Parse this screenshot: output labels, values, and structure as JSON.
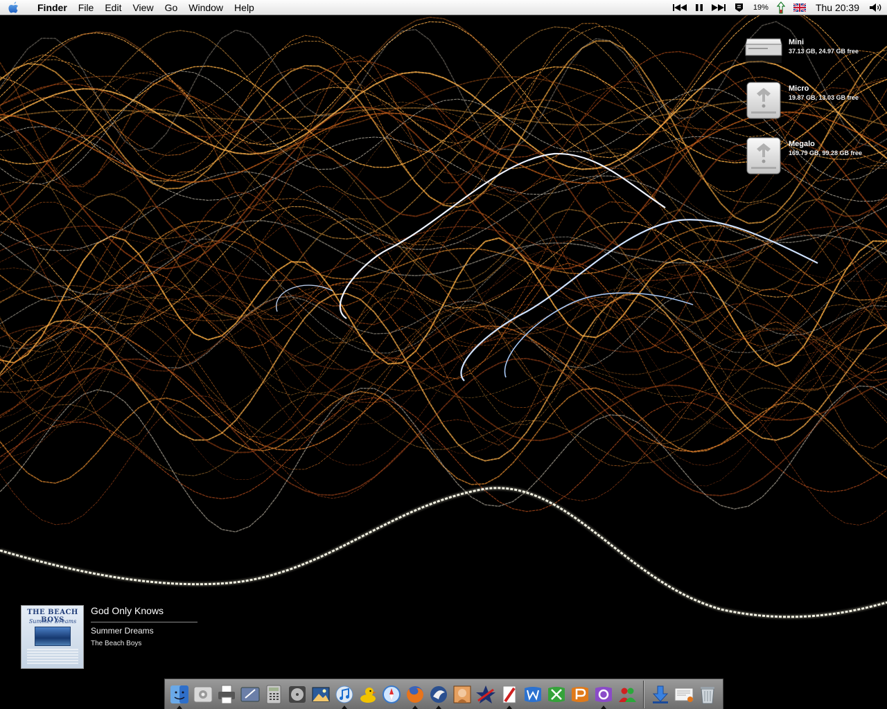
{
  "menubar": {
    "app_name": "Finder",
    "menus": [
      "File",
      "Edit",
      "View",
      "Go",
      "Window",
      "Help"
    ],
    "battery_percent": "19%",
    "clock": "Thu 20:39"
  },
  "desktop": {
    "drives": [
      {
        "name": "Mini",
        "info": "37.13 GB, 24.97 GB free"
      },
      {
        "name": "Micro",
        "info": "19.87 GB, 13.03 GB free"
      },
      {
        "name": "Megalo",
        "info": "169.79 GB, 99.28 GB free"
      }
    ]
  },
  "now_playing": {
    "track": "God Only Knows",
    "album": "Summer Dreams",
    "artist": "The Beach Boys",
    "art_band": "THE BEACH BOYS",
    "art_script": "Summer Dreams"
  },
  "dock": {
    "items": [
      {
        "icon": "finder-icon",
        "running": true
      },
      {
        "icon": "system-preferences-icon",
        "running": false
      },
      {
        "icon": "printer-icon",
        "running": false
      },
      {
        "icon": "drawing-app-icon",
        "running": false
      },
      {
        "icon": "calculator-icon",
        "running": false
      },
      {
        "icon": "dvd-player-icon",
        "running": false
      },
      {
        "icon": "iphoto-icon",
        "running": false
      },
      {
        "icon": "itunes-icon",
        "running": true
      },
      {
        "icon": "cyberduck-icon",
        "running": false
      },
      {
        "icon": "safari-icon",
        "running": false
      },
      {
        "icon": "firefox-icon",
        "running": true
      },
      {
        "icon": "camino-icon",
        "running": true
      },
      {
        "icon": "photo-editor-icon",
        "running": false
      },
      {
        "icon": "nvu-icon",
        "running": false
      },
      {
        "icon": "textwrangler-icon",
        "running": true
      },
      {
        "icon": "word-icon",
        "running": false
      },
      {
        "icon": "excel-icon",
        "running": false
      },
      {
        "icon": "powerpoint-icon",
        "running": false
      },
      {
        "icon": "entourage-icon",
        "running": true
      },
      {
        "icon": "messenger-icon",
        "running": false
      }
    ],
    "right_items": [
      {
        "icon": "downloads-icon",
        "running": false
      },
      {
        "icon": "document-icon",
        "running": false
      },
      {
        "icon": "trash-icon",
        "running": false
      }
    ]
  }
}
